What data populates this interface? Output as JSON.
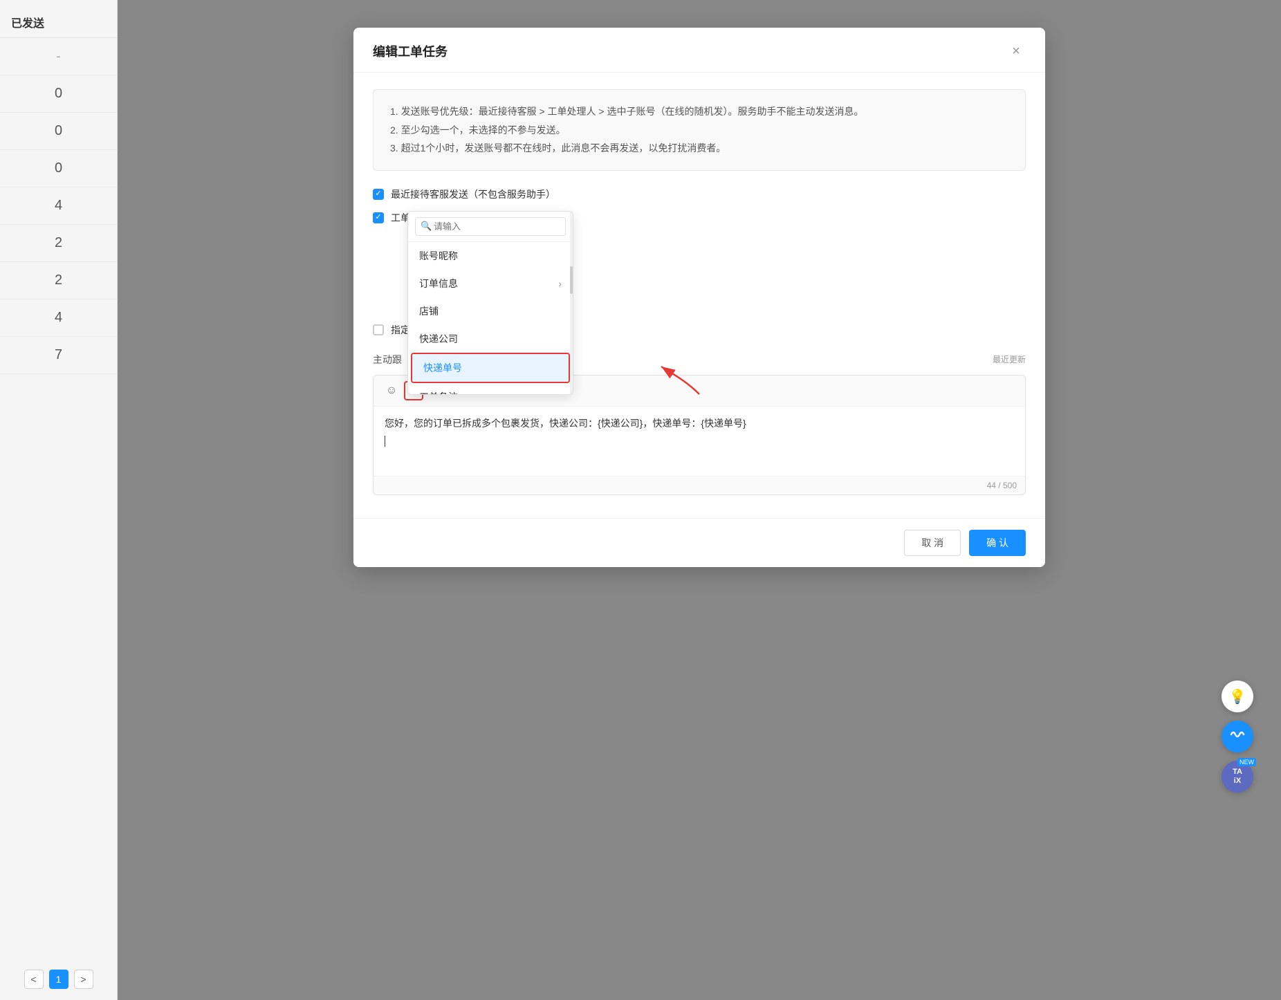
{
  "sidebar": {
    "header": "已发送",
    "items": [
      {
        "value": "-"
      },
      {
        "value": "0"
      },
      {
        "value": "0"
      },
      {
        "value": "0"
      },
      {
        "value": "4"
      },
      {
        "value": "2"
      },
      {
        "value": "2"
      },
      {
        "value": "4"
      },
      {
        "value": "7"
      }
    ],
    "pagination": {
      "prev": "<",
      "page": "1",
      "next": ">"
    }
  },
  "modal": {
    "title": "编辑工单任务",
    "close": "×",
    "info": {
      "line1": "1. 发送账号优先级：最近接待客服 > 工单处理人 > 选中子账号（在线的随机发）。服务助手不能主动发送消息。",
      "line2": "2. 至少勾选一个，未选择的不参与发送。",
      "line3": "3. 超过1个小时，发送账号都不在线时，此消息不会再发送，以免打扰消费者。"
    },
    "checkbox1": {
      "checked": true,
      "label": "最近接待客服发送（不包含服务助手）"
    },
    "checkbox2": {
      "checked": true,
      "label": "工单"
    },
    "checkbox3": {
      "checked": false,
      "label": "指定"
    },
    "dropdown": {
      "search_placeholder": "请输入",
      "items": [
        {
          "label": "账号昵称",
          "arrow": false,
          "highlighted": false
        },
        {
          "label": "订单信息",
          "arrow": true,
          "highlighted": false
        },
        {
          "label": "店铺",
          "arrow": false,
          "highlighted": false
        },
        {
          "label": "快递公司",
          "arrow": false,
          "highlighted": false
        },
        {
          "label": "快递单号",
          "arrow": false,
          "highlighted": true
        },
        {
          "label": "工单备注",
          "arrow": false,
          "highlighted": false
        }
      ]
    },
    "section": {
      "label": "主动跟",
      "update": "最近更新"
    },
    "message_toolbar": {
      "emoji": "☺",
      "var_btn": "⊡",
      "image": "□"
    },
    "message_text": "您好，您的订单已拆成多个包裹发货，快递公司：{快递公司}，快递单号：{快递单号}",
    "message_counter": "44 / 500",
    "footer": {
      "cancel": "取 消",
      "confirm": "确 认"
    }
  },
  "float_buttons": {
    "light_icon": "💡",
    "wave_icon": "〜",
    "ai_label": "TA iX",
    "new_badge": "NEW"
  }
}
